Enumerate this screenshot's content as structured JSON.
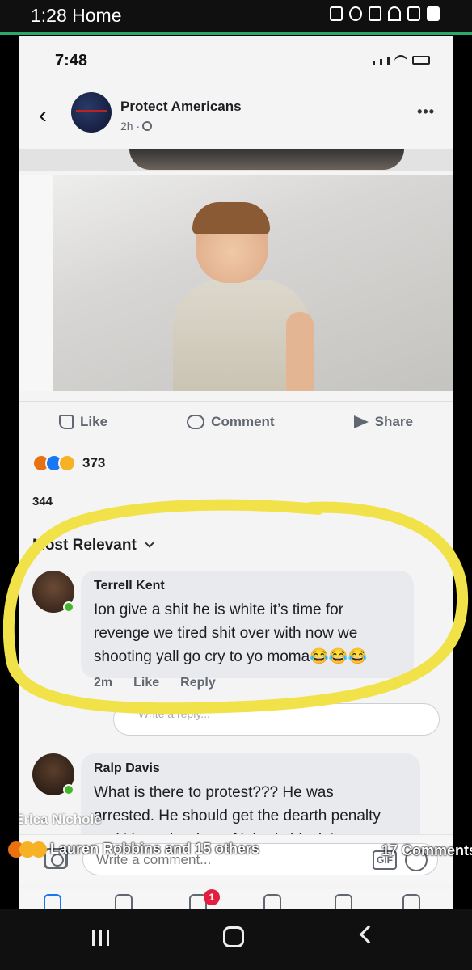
{
  "outer_status": {
    "time": "1:28 Home"
  },
  "inner_status": {
    "time": "7:48"
  },
  "post": {
    "page_name": "Protect Americans",
    "time": "2h ·",
    "actions": {
      "like": "Like",
      "comment": "Comment",
      "share": "Share"
    },
    "reaction_count": "373",
    "count_partial": "344"
  },
  "comments_section": {
    "sort_label": "Most Relevant",
    "comments": [
      {
        "name": "Terrell Kent",
        "text_lines": [
          "Ion give a shit he is white it’s time for",
          "revenge we tired shit over with now we",
          "shooting yall go cry to yo moma😂😂😂"
        ],
        "time": "2m",
        "like": "Like",
        "reply": "Reply"
      },
      {
        "name": "Ralp Davis",
        "text_lines": [
          "What is there to protest??? He was",
          "arrested. He should get the dearth penalty",
          "and i hope he does. Nobody black is up"
        ]
      }
    ],
    "reply_placeholder": "Write a reply..."
  },
  "composer": {
    "placeholder": "Write a comment...",
    "gif": "GIF"
  },
  "overlay": {
    "watermark": "Erica Nichole",
    "reactions_text": "Lauren Robbins and 15 others",
    "comments_text": "17 Comments"
  },
  "tabbar": {
    "badge": "1"
  },
  "colors": {
    "highlight": "#f2e24a",
    "facebook_blue": "#1877f2",
    "online": "#42b72a"
  }
}
